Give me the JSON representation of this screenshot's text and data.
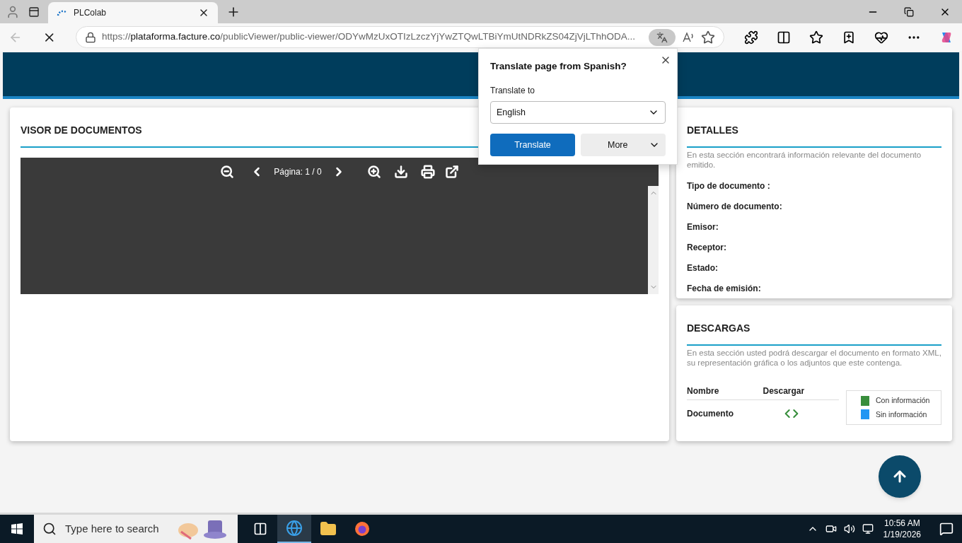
{
  "browser": {
    "tabs": [
      {
        "title": "PLColab",
        "selected": true
      }
    ],
    "address": {
      "scheme": "https://",
      "host": "plataforma.facture.co",
      "path": "/publicViewer/public-viewer/ODYwMzUxOTIzLzczYjYwZTQwLTBiYmUtNDRkZS04ZjVjLThhODA..."
    }
  },
  "viewer": {
    "title": "VISOR DE DOCUMENTOS",
    "page_label": "Página: 1 / 0"
  },
  "details": {
    "title": "DETALLES",
    "description": "En esta sección encontrará información relevante del documento emitido.",
    "fields": [
      "Tipo de documento :",
      "Número de documento:",
      "Emisor:",
      "Receptor:",
      "Estado:",
      "Fecha de emisión:"
    ]
  },
  "downloads": {
    "title": "DESCARGAS",
    "description": "En esta sección usted podrá descargar el documento en formato XML, su representación gráfica o los adjuntos que este contenga.",
    "columns": [
      "Nombre",
      "Descargar"
    ],
    "rows": [
      {
        "name": "Documento",
        "color": "#388e3c"
      }
    ],
    "legend": [
      {
        "label": "Con información",
        "color": "#388e3c"
      },
      {
        "label": "Sin información",
        "color": "#2196f3"
      }
    ]
  },
  "translate_popup": {
    "title": "Translate page from Spanish?",
    "label": "Translate to",
    "language": "English",
    "translate_button": "Translate",
    "more_button": "More"
  },
  "taskbar": {
    "search_placeholder": "Type here to search",
    "time": "10:56 AM",
    "date": "1/19/2026"
  }
}
